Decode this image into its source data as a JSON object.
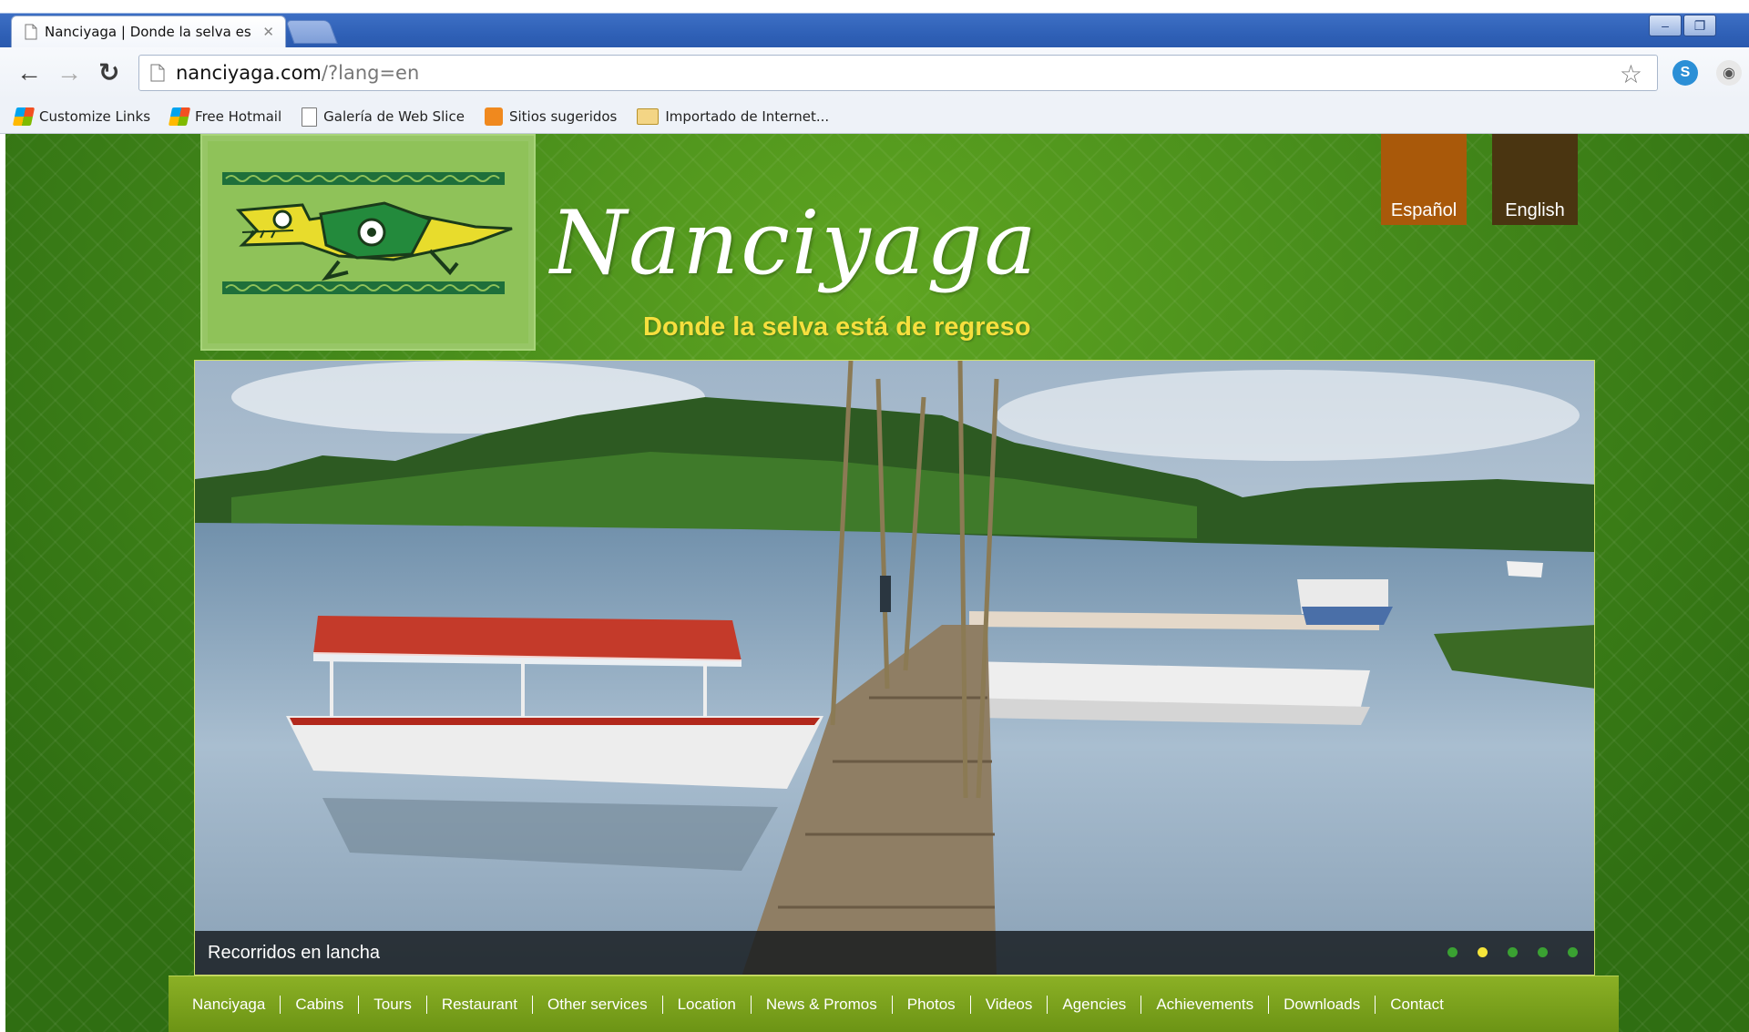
{
  "browser": {
    "tab_title": "Nanciyaga | Donde la selva es",
    "url_host": "nanciyaga.com",
    "url_path": "/?lang=en",
    "bookmarks": [
      "Customize Links",
      "Free Hotmail",
      "Galería de Web Slice",
      "Sitios sugeridos",
      "Importado de Internet..."
    ]
  },
  "site": {
    "brand": "Nanciyaga",
    "tagline": "Donde la selva está de regreso",
    "languages": [
      "Español",
      "English"
    ],
    "slider": {
      "caption": "Recorridos en lancha",
      "slide_count": 5,
      "active_slide": 2
    },
    "menu": [
      "Nanciyaga",
      "Cabins",
      "Tours",
      "Restaurant",
      "Other services",
      "Location",
      "News & Promos",
      "Photos",
      "Videos",
      "Agencies",
      "Achievements",
      "Downloads",
      "Contact"
    ]
  },
  "colors": {
    "background_green": "#43881a",
    "tagline_yellow": "#f6df3e",
    "lang_es": "#a9590a",
    "lang_en": "#4a3511",
    "menu_green": "#7da01d",
    "dot_active": "#f5e53a",
    "dot_inactive": "#3aa132"
  }
}
